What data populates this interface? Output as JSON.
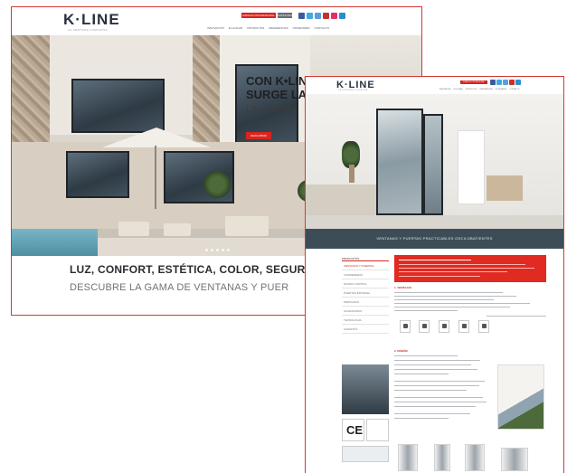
{
  "site": {
    "logo": "K·LINE",
    "logo_tagline": "LA VENTANA LUMINOSA"
  },
  "back_page": {
    "header": {
      "btn_primary": "ESPACIO PROFESIONAL",
      "btn_secondary": "CATÁLOGO",
      "nav": [
        "INNOVACIÓN",
        "EL HOGAR",
        "PRODUCTOS",
        "REFERENCIAS",
        "NOVEDADES",
        "CONTACTO"
      ]
    },
    "hero": {
      "title_line1": "CON K•LIN",
      "title_line2": "SURGE LA",
      "subtitle": "La esbeltez",
      "cta": "DESCUBRIR"
    },
    "tagline_main": "LUZ, CONFORT, ESTÉTICA, COLOR, SEGURID",
    "tagline_sub": "DESCUBRE LA GAMA DE VENTANAS Y PUER"
  },
  "front_page": {
    "header": {
      "btn_primary": "ESPACIO PROFESIONAL",
      "nav": [
        "INNOVACIÓN",
        "EL HOGAR",
        "PRODUCTOS",
        "REFERENCIAS",
        "NOVEDADES",
        "CONTACTO"
      ]
    },
    "band_title": "VENTANAS Y PUERTAS PRACTICABLES OSCILOBATIENTES",
    "sidebar": {
      "head": "PRODUCTOS",
      "items": [
        "VENTANAS Y PUERTAS",
        "CORREDERAS",
        "MUROS CORTINA",
        "PUERTAS ENTRADA",
        "PERSIANAS",
        "ACCESORIOS",
        "TECNOLOGÍA",
        "GARANTÍA"
      ]
    },
    "ce_mark": "CE",
    "sections": {
      "advantages": "1. VENTAJAS",
      "design": "2. DISEÑO"
    }
  },
  "colors": {
    "brand_red": "#d6261f",
    "band_blue": "#3d4d58",
    "frame_red": "#cf3a36"
  },
  "icons": [
    "facebook-icon",
    "twitter-icon",
    "youtube-icon",
    "pinterest-icon",
    "linkedin-icon"
  ]
}
